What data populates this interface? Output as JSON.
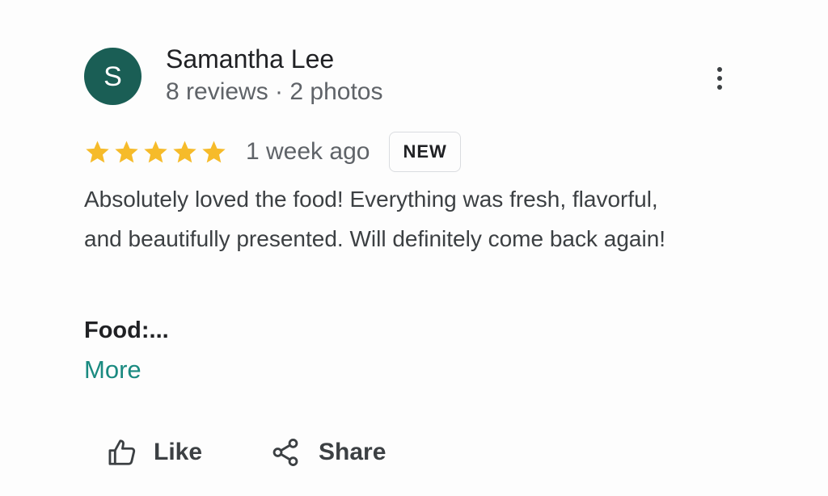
{
  "reviewer": {
    "initial": "S",
    "avatar_color": "#1a5e55",
    "name": "Samantha Lee",
    "meta": "8 reviews · 2 photos"
  },
  "menu": {
    "icon": "more-vert-icon"
  },
  "review": {
    "rating": 5,
    "max_rating": 5,
    "star_color": "#f6bb2a",
    "date": "1 week ago",
    "badge": "NEW",
    "text": "Absolutely loved the food! Everything was fresh, flavorful, and beautifully presented. Will definitely come back again!",
    "section_label": "Food:...",
    "more_label": "More"
  },
  "actions": {
    "like_label": "Like",
    "like_icon": "thumbs-up-icon",
    "share_label": "Share",
    "share_icon": "share-icon"
  },
  "colors": {
    "link": "#1a8a80"
  }
}
